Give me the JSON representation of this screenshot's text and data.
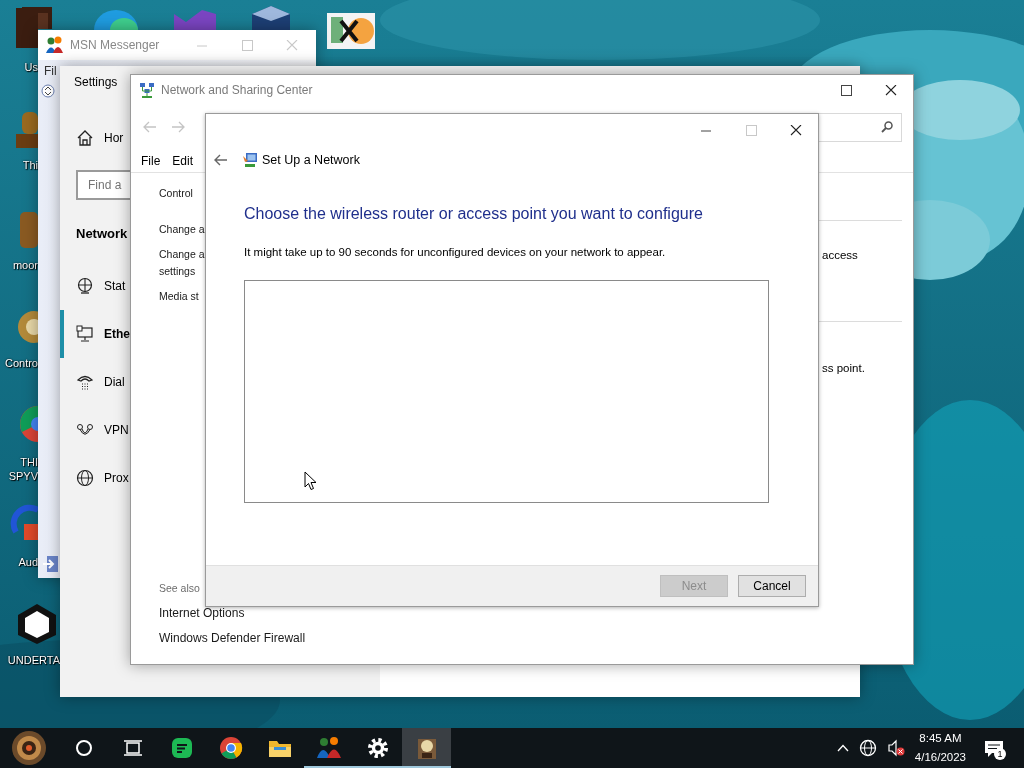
{
  "desktop": {
    "icons": [
      {
        "lines": [
          "Us"
        ]
      },
      {
        "lines": [
          "Thi"
        ]
      },
      {
        "lines": [
          "moor"
        ]
      },
      {
        "lines": [
          "Contro"
        ]
      },
      {
        "lines": [
          "THI",
          "SPYV"
        ]
      },
      {
        "lines": [
          "Aud"
        ]
      },
      {
        "lines": [
          "UNDERTA"
        ]
      }
    ]
  },
  "msn_window": {
    "title": "MSN Messenger",
    "menu": "Fil"
  },
  "settings_window": {
    "title": "Settings",
    "home": "Hor",
    "search": {
      "placeholder": "Find a"
    },
    "section": "Network",
    "items": [
      {
        "kind": "status",
        "label": "Stat",
        "selected": false
      },
      {
        "kind": "ethernet",
        "label": "Ethe",
        "selected": true
      },
      {
        "kind": "dialup",
        "label": "Dial",
        "selected": false
      },
      {
        "kind": "vpn",
        "label": "VPN",
        "selected": false
      },
      {
        "kind": "proxy",
        "label": "Prox",
        "selected": false
      }
    ]
  },
  "network_center": {
    "title": "Network and Sharing Center",
    "menu": [
      "File",
      "Edit"
    ],
    "sidebar": [
      {
        "lines": [
          "Control"
        ]
      },
      {
        "lines": [
          "Change a"
        ]
      },
      {
        "lines": [
          "Change a",
          "settings"
        ]
      },
      {
        "lines": [
          "Media st"
        ]
      }
    ],
    "right_texts": [
      "access",
      "ss point."
    ],
    "see_also": {
      "heading": "See also",
      "links": [
        "Internet Options",
        "Windows Defender Firewall"
      ]
    }
  },
  "dialog": {
    "title": "Set Up a Network",
    "heading": "Choose the wireless router or access point you want to configure",
    "description": "It might take up to 90 seconds for unconfigured devices on your network to appear.",
    "buttons": [
      {
        "label": "Next",
        "disabled": true
      },
      {
        "label": "Cancel",
        "disabled": false
      }
    ]
  },
  "taskbar": {
    "apps": [
      {
        "kind": "start",
        "running": false,
        "selected": false
      },
      {
        "kind": "search",
        "running": false,
        "selected": false
      },
      {
        "kind": "task_view",
        "running": false,
        "selected": false
      },
      {
        "kind": "notes",
        "running": false,
        "selected": false
      },
      {
        "kind": "chrome",
        "running": false,
        "selected": false
      },
      {
        "kind": "explorer",
        "running": false,
        "selected": false
      },
      {
        "kind": "messenger",
        "running": true,
        "selected": false
      },
      {
        "kind": "settings",
        "running": true,
        "selected": false
      },
      {
        "kind": "app",
        "running": true,
        "selected": true
      }
    ],
    "clock": {
      "time": "8:45 AM",
      "date": "4/16/2023"
    },
    "notifications": "1"
  }
}
